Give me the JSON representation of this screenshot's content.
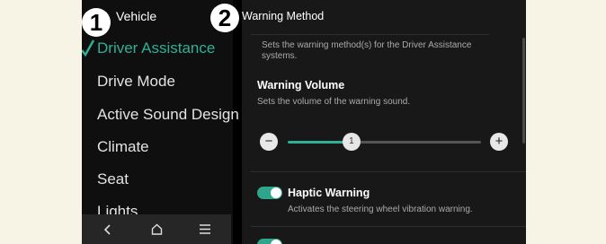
{
  "callouts": {
    "left": "1",
    "right": "2"
  },
  "header": {
    "left_title": "Vehicle",
    "right_title": "Warning Method"
  },
  "nav": {
    "items": [
      {
        "label": "Driver Assistance",
        "active": true
      },
      {
        "label": "Drive Mode"
      },
      {
        "label": "Active Sound Design"
      },
      {
        "label": "Climate"
      },
      {
        "label": "Seat"
      },
      {
        "label": "Lights"
      }
    ]
  },
  "bottom_bar": {
    "icons": [
      "back-icon",
      "home-icon",
      "menu-icon"
    ]
  },
  "content": {
    "intro": "Sets the warning method(s) for the Driver Assistance systems.",
    "volume": {
      "title": "Warning Volume",
      "description": "Sets the volume of the warning sound.",
      "minus": "−",
      "plus": "+",
      "value": "1",
      "fraction": 0.33
    },
    "haptic": {
      "title": "Haptic Warning",
      "description": "Activates the steering wheel vibration warning.",
      "enabled": true
    }
  },
  "colors": {
    "accent": "#2fb095",
    "toggle_on": "#2fa58b",
    "screen_bg": "#000000",
    "page_bg": "#f7f3e5"
  }
}
